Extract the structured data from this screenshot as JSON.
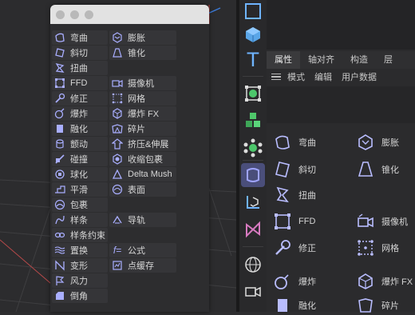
{
  "window": {
    "title": ""
  },
  "menu": {
    "left": [
      "弯曲",
      "斜切",
      "扭曲",
      "FFD",
      "修正",
      "爆炸",
      "融化",
      "颤动",
      "碰撞",
      "球化",
      "平滑",
      "包裹",
      "样条",
      "样条约束",
      "置换",
      "变形",
      "风力",
      "倒角"
    ],
    "right": [
      "膨胀",
      "锥化",
      "",
      "摄像机",
      "网格",
      "爆炸 FX",
      "碎片",
      "挤压&伸展",
      "收缩包裹",
      "Delta Mush",
      "表面",
      "",
      "导轨",
      "",
      "公式",
      "点缓存"
    ]
  },
  "panel": {
    "tabs": [
      "属性",
      "轴对齐",
      "构造",
      "层"
    ],
    "subtabs": [
      "模式",
      "编辑",
      "用户数据"
    ]
  },
  "grid": {
    "left": [
      "弯曲",
      "斜切",
      "扭曲",
      "FFD",
      "修正",
      "爆炸",
      "融化"
    ],
    "right": [
      "膨胀",
      "锥化",
      "",
      "摄像机",
      "网格",
      "爆炸 FX",
      "碎片"
    ]
  },
  "toolbar": {
    "label": "T"
  },
  "colors": {
    "accent": "#8a8fe8",
    "menu_bg": "#2d2d2f",
    "item_bg": "#353538",
    "selected": "#4a4e7a"
  }
}
